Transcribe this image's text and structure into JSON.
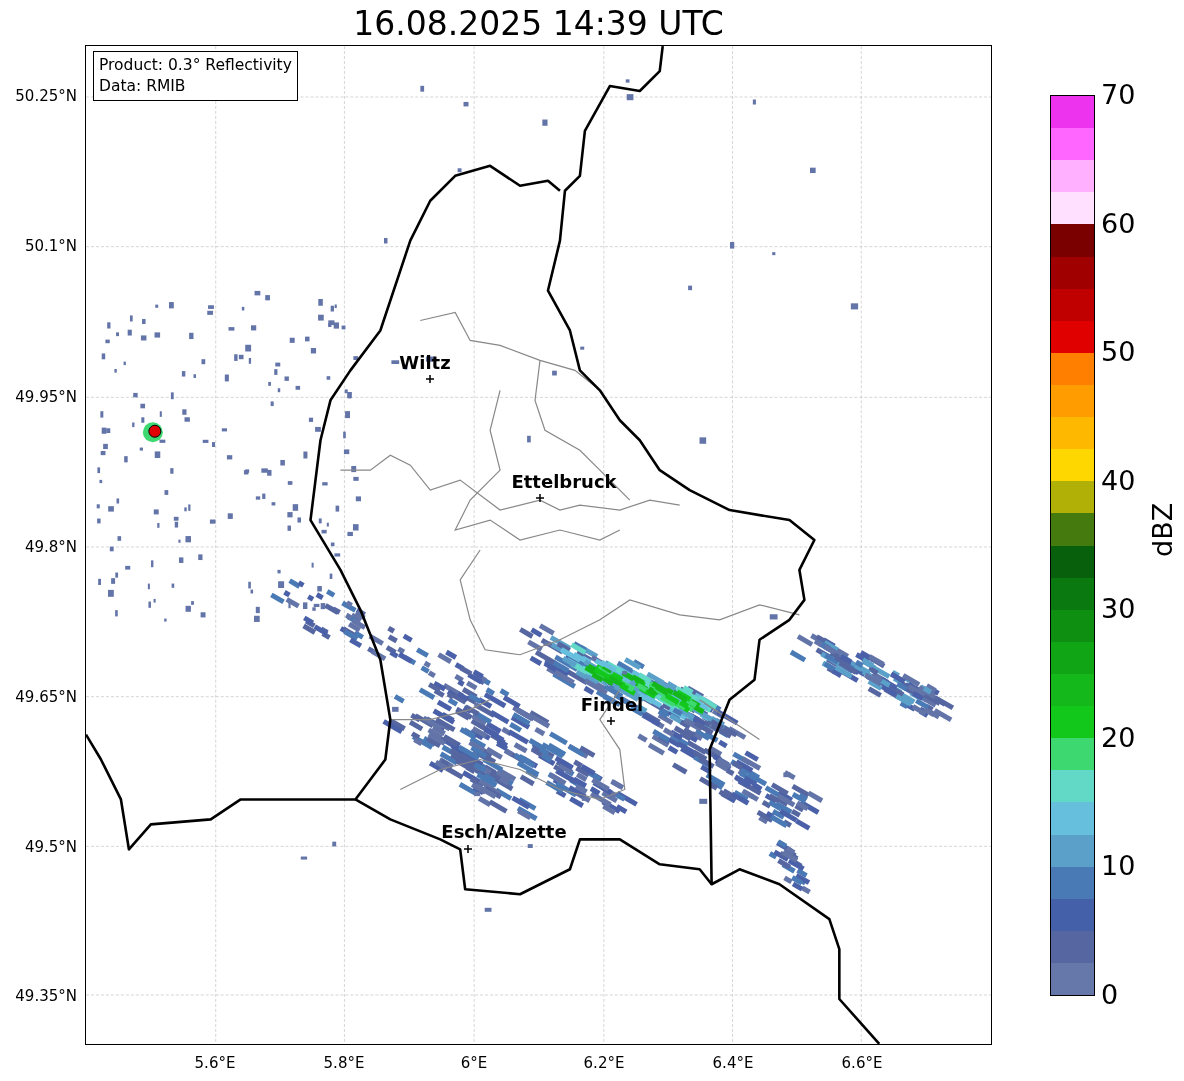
{
  "title": "16.08.2025 14:39 UTC",
  "info_box": {
    "lines": [
      "Product: 0.3° Reflectivity",
      "Data: RMIB"
    ]
  },
  "map": {
    "lat_labels": [
      "50.25°N",
      "50.1°N",
      "49.95°N",
      "49.8°N",
      "49.65°N",
      "49.5°N",
      "49.35°N"
    ],
    "lon_labels": [
      "5.6°E",
      "5.8°E",
      "6°E",
      "6.2°E",
      "6.4°E",
      "6.6°E"
    ],
    "places": [
      {
        "name": "Wiltz"
      },
      {
        "name": "Ettelbruck"
      },
      {
        "name": "Findel"
      },
      {
        "name": "Esch/Alzette"
      }
    ]
  },
  "colorbar": {
    "label": "dBZ",
    "ticks": [
      "70",
      "60",
      "50",
      "40",
      "30",
      "20",
      "10",
      "0"
    ],
    "segments": [
      {
        "color": "#ee33ee"
      },
      {
        "color": "#ff66ff"
      },
      {
        "color": "#ffb0ff"
      },
      {
        "color": "#ffe0ff"
      },
      {
        "color": "#7a0000"
      },
      {
        "color": "#a00000"
      },
      {
        "color": "#c00000"
      },
      {
        "color": "#e00000"
      },
      {
        "color": "#ff7f00"
      },
      {
        "color": "#ff9d00"
      },
      {
        "color": "#ffb800"
      },
      {
        "color": "#ffd700"
      },
      {
        "color": "#b0b006"
      },
      {
        "color": "#457a0e"
      },
      {
        "color": "#08600c"
      },
      {
        "color": "#0a7a10"
      },
      {
        "color": "#0e8f12"
      },
      {
        "color": "#10a514"
      },
      {
        "color": "#14b81a"
      },
      {
        "color": "#12c81a"
      },
      {
        "color": "#3dd870"
      },
      {
        "color": "#62d8c6"
      },
      {
        "color": "#66c0dd"
      },
      {
        "color": "#5aa0c8"
      },
      {
        "color": "#4a7ab5"
      },
      {
        "color": "#4460a8"
      },
      {
        "color": "#5566a0"
      },
      {
        "color": "#6677aa"
      }
    ]
  }
}
